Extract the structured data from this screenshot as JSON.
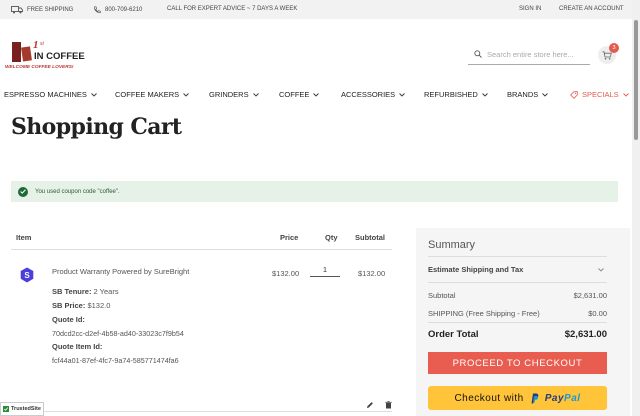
{
  "topbar": {
    "free_shipping": "FREE SHIPPING",
    "phone": "800-709-6210",
    "advice": "CALL FOR EXPERT ADVICE ~ 7 DAYS A WEEK",
    "sign_in": "SIGN IN",
    "create_account": "CREATE AN ACCOUNT"
  },
  "logo": {
    "text": "1st IN COFFEE",
    "tagline": "WELCOME COFFEE LOVERS!"
  },
  "search": {
    "placeholder": "Search entire store here..."
  },
  "cart": {
    "count": "3"
  },
  "nav": {
    "items": [
      {
        "label": "ESPRESSO MACHINES"
      },
      {
        "label": "COFFEE MAKERS"
      },
      {
        "label": "GRINDERS"
      },
      {
        "label": "COFFEE"
      },
      {
        "label": "ACCESSORIES"
      },
      {
        "label": "REFURBISHED"
      },
      {
        "label": "BRANDS"
      },
      {
        "label": "SPECIALS"
      }
    ]
  },
  "page_title": "Shopping Cart",
  "message": "You used coupon code \"coffee\".",
  "cart_table": {
    "headers": {
      "item": "Item",
      "price": "Price",
      "qty": "Qty",
      "subtotal": "Subtotal"
    },
    "item": {
      "name": "Product Warranty Powered by SureBright",
      "price": "$132.00",
      "qty": "1",
      "subtotal": "$132.00",
      "options": {
        "tenure_label": "SB Tenure:",
        "tenure_value": "2 Years",
        "price_label": "SB Price:",
        "price_value": "$132.0",
        "quote_id_label": "Quote Id:",
        "quote_id_value": "70dcd2cc-d2ef-4b58-ad40-33023c7f9b54",
        "quote_item_id_label": "Quote Item Id:",
        "quote_item_id_value": "fcf44a01-87ef-4fc7-9a74-585771474fa6"
      }
    }
  },
  "summary": {
    "title": "Summary",
    "estimate": "Estimate Shipping and Tax",
    "subtotal_label": "Subtotal",
    "subtotal_value": "$2,631.00",
    "shipping_label": "SHIPPING (Free Shipping - Free)",
    "shipping_value": "$0.00",
    "total_label": "Order Total",
    "total_value": "$2,631.00",
    "checkout_label": "PROCEED TO CHECKOUT",
    "paypal_prefix": "Checkout with",
    "paypal_brand_a": "Pay",
    "paypal_brand_b": "Pal"
  },
  "trusted": "TrustedSite"
}
